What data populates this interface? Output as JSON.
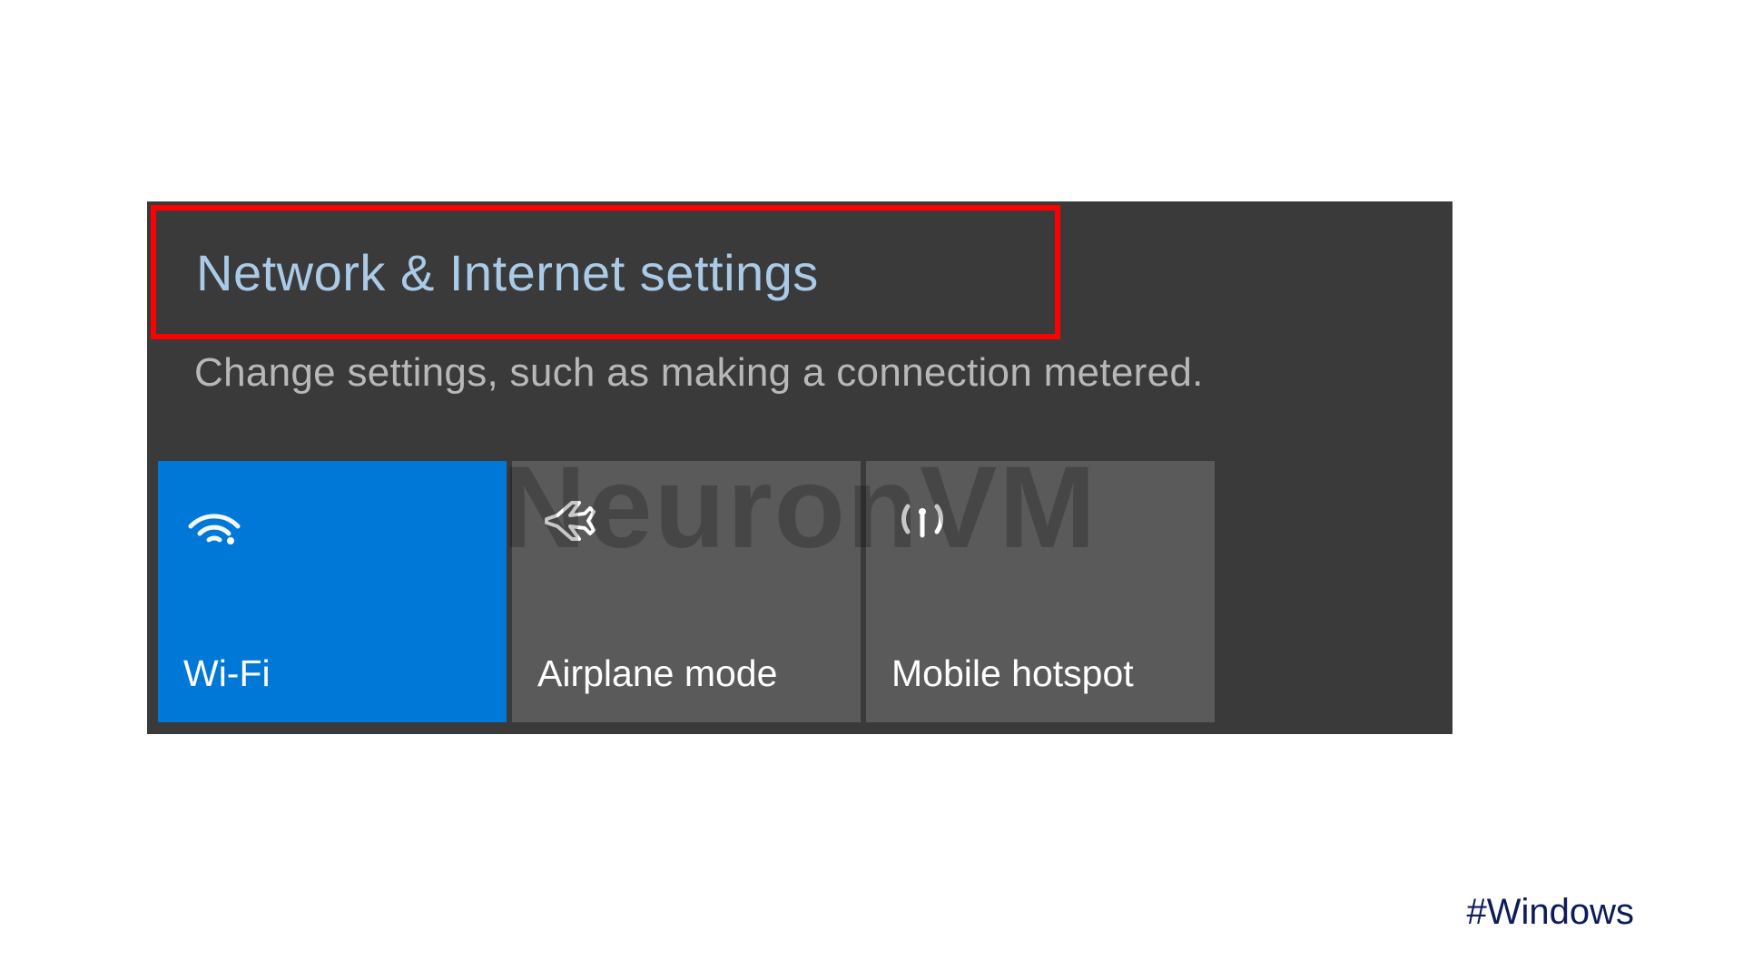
{
  "header": {
    "title": "Network & Internet settings",
    "subtitle": "Change settings, such as making a connection metered."
  },
  "tiles": [
    {
      "icon": "wifi-icon",
      "label": "Wi-Fi",
      "active": true
    },
    {
      "icon": "airplane-icon",
      "label": "Airplane mode",
      "active": false
    },
    {
      "icon": "hotspot-icon",
      "label": "Mobile hotspot",
      "active": false
    }
  ],
  "watermark": "NeuronVM",
  "hashtag": "#Windows",
  "colors": {
    "highlight_border": "#ff0000",
    "accent": "#0078d7",
    "panel_bg": "#3a3a3a",
    "tile_inactive_bg": "#5a5a5a",
    "title_color": "#a9cbe8",
    "subtitle_color": "#b8b8b8",
    "hashtag_color": "#0d1b5c"
  }
}
